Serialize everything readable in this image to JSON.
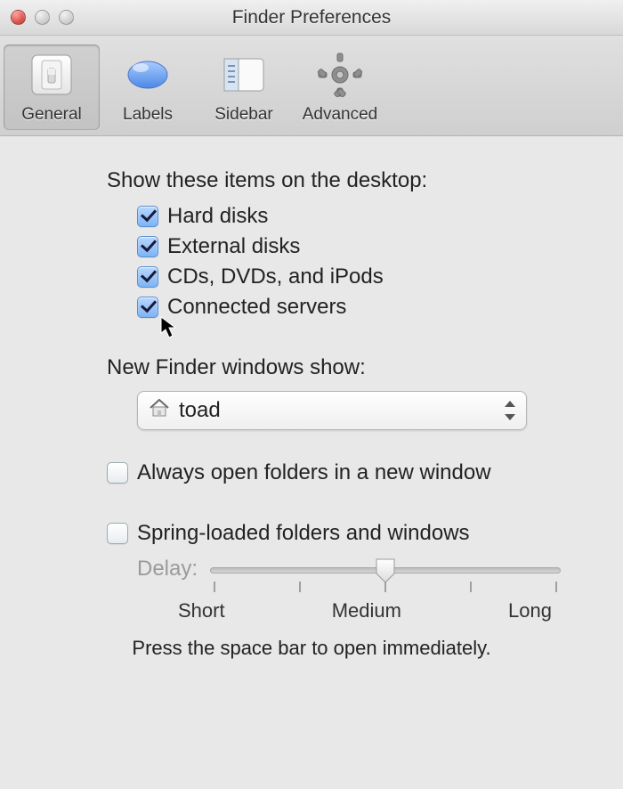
{
  "window": {
    "title": "Finder Preferences"
  },
  "toolbar": {
    "items": [
      {
        "label": "General",
        "selected": true
      },
      {
        "label": "Labels",
        "selected": false
      },
      {
        "label": "Sidebar",
        "selected": false
      },
      {
        "label": "Advanced",
        "selected": false
      }
    ]
  },
  "desktop_items": {
    "title": "Show these items on the desktop:",
    "options": [
      {
        "label": "Hard disks",
        "checked": true
      },
      {
        "label": "External disks",
        "checked": true
      },
      {
        "label": "CDs, DVDs, and iPods",
        "checked": true
      },
      {
        "label": "Connected servers",
        "checked": true
      }
    ]
  },
  "new_window": {
    "title": "New Finder windows show:",
    "selected": "toad"
  },
  "always_open": {
    "label": "Always open folders in a new window",
    "checked": false
  },
  "spring": {
    "label": "Spring-loaded folders and windows",
    "checked": false,
    "delay_label": "Delay:",
    "position_percent": 50,
    "ticks": 5,
    "legend": {
      "short": "Short",
      "medium": "Medium",
      "long": "Long"
    },
    "hint": "Press the space bar to open immediately."
  }
}
